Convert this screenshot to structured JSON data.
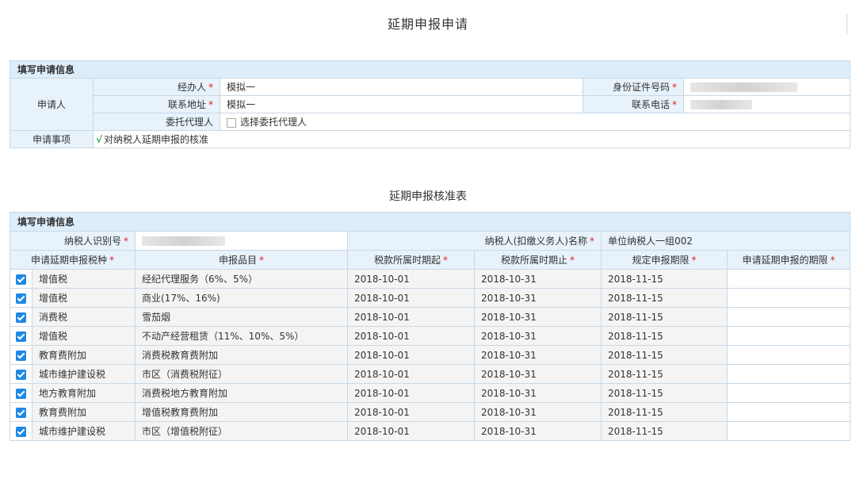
{
  "page": {
    "title": "延期申报申请"
  },
  "application": {
    "section_title": "填写申请信息",
    "applicant_label": "申请人",
    "handler_label": "经办人",
    "handler_value": "模拟一",
    "id_label": "身份证件号码",
    "address_label": "联系地址",
    "address_value": "模拟一",
    "phone_label": "联系电话",
    "agent_label": "委托代理人",
    "agent_option": "选择委托代理人",
    "matter_label": "申请事项",
    "matter_mark": "√",
    "matter_value": "对纳税人延期申报的核准"
  },
  "approval": {
    "title": "延期申报核准表",
    "section_title": "填写申请信息",
    "taxpayer_id_label": "纳税人识别号",
    "taxpayer_name_label": "纳税人(扣缴义务人)名称",
    "taxpayer_name_value": "单位纳税人一组002",
    "columns": [
      "申请延期申报税种",
      "申报品目",
      "税款所属时期起",
      "税款所属时期止",
      "规定申报期限",
      "申请延期申报的期限"
    ],
    "rows": [
      {
        "checked": true,
        "tax_type": "增值税",
        "item": "经纪代理服务（6%、5%）",
        "start": "2018-10-01",
        "end": "2018-10-31",
        "deadline": "2018-11-15",
        "extension": ""
      },
      {
        "checked": true,
        "tax_type": "增值税",
        "item": "商业(17%、16%)",
        "start": "2018-10-01",
        "end": "2018-10-31",
        "deadline": "2018-11-15",
        "extension": ""
      },
      {
        "checked": true,
        "tax_type": "消费税",
        "item": "雪茄烟",
        "start": "2018-10-01",
        "end": "2018-10-31",
        "deadline": "2018-11-15",
        "extension": ""
      },
      {
        "checked": true,
        "tax_type": "增值税",
        "item": "不动产经营租赁（11%、10%、5%）",
        "start": "2018-10-01",
        "end": "2018-10-31",
        "deadline": "2018-11-15",
        "extension": ""
      },
      {
        "checked": true,
        "tax_type": "教育费附加",
        "item": "消费税教育费附加",
        "start": "2018-10-01",
        "end": "2018-10-31",
        "deadline": "2018-11-15",
        "extension": ""
      },
      {
        "checked": true,
        "tax_type": "城市维护建设税",
        "item": "市区（消费税附征）",
        "start": "2018-10-01",
        "end": "2018-10-31",
        "deadline": "2018-11-15",
        "extension": ""
      },
      {
        "checked": true,
        "tax_type": "地方教育附加",
        "item": "消费税地方教育附加",
        "start": "2018-10-01",
        "end": "2018-10-31",
        "deadline": "2018-11-15",
        "extension": ""
      },
      {
        "checked": true,
        "tax_type": "教育费附加",
        "item": "增值税教育费附加",
        "start": "2018-10-01",
        "end": "2018-10-31",
        "deadline": "2018-11-15",
        "extension": ""
      },
      {
        "checked": true,
        "tax_type": "城市维护建设税",
        "item": "市区（增值税附征）",
        "start": "2018-10-01",
        "end": "2018-10-31",
        "deadline": "2018-11-15",
        "extension": ""
      }
    ]
  },
  "colors": {
    "header_bg": "#ddeefa",
    "label_bg": "#e7f2fb",
    "border": "#c9d8e6",
    "checkbox": "#1e88e5",
    "required": "#e02020",
    "tick": "#2fa84f"
  }
}
